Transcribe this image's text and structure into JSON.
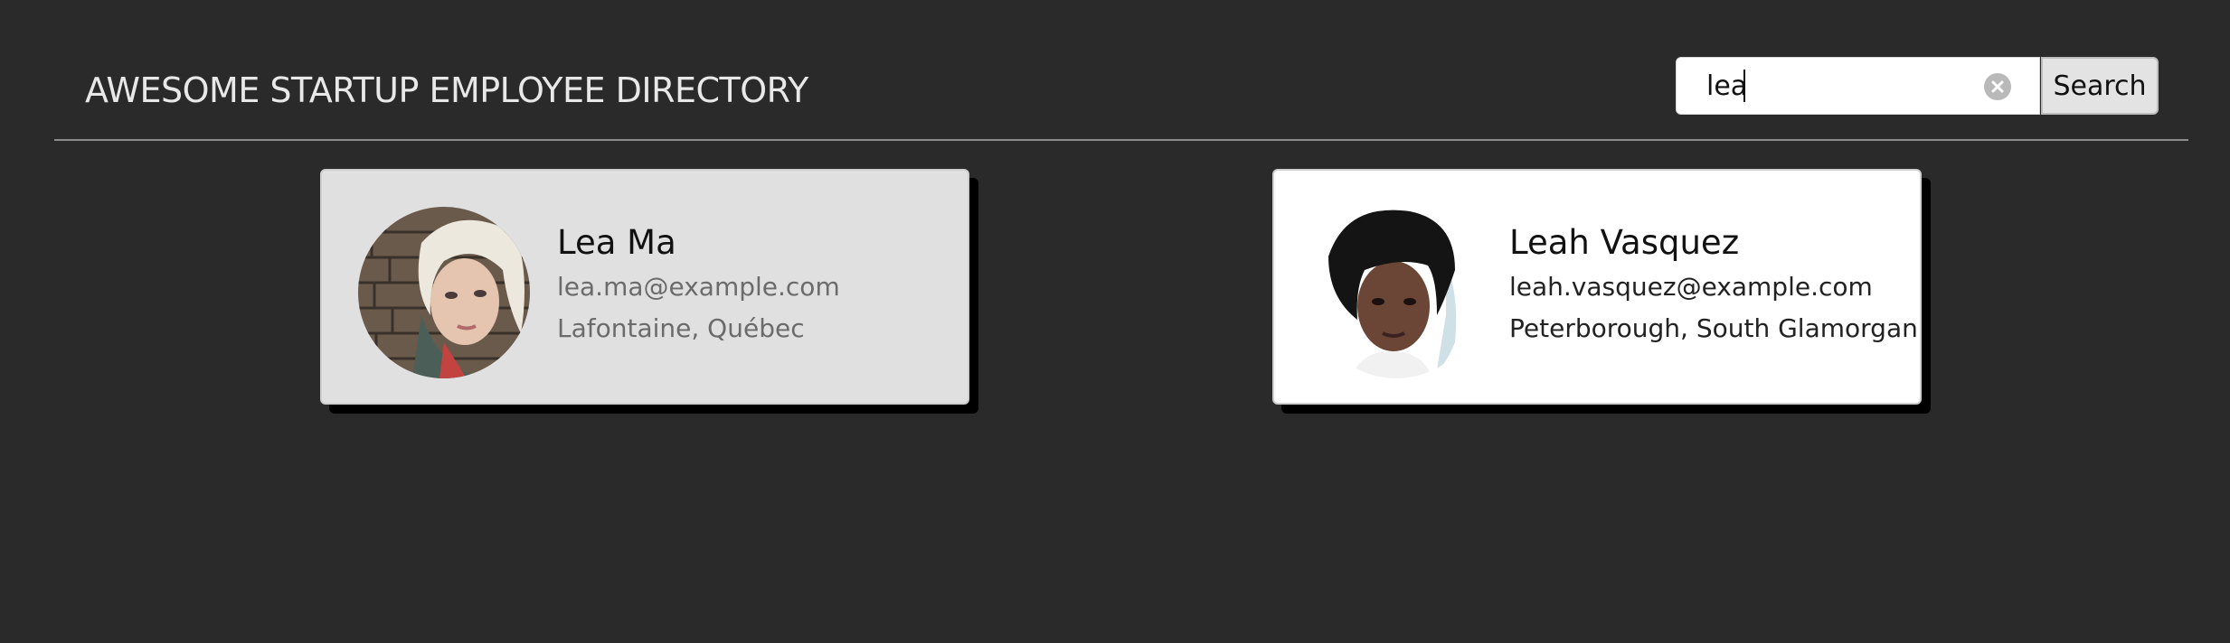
{
  "header": {
    "title": "AWESOME STARTUP EMPLOYEE DIRECTORY"
  },
  "search": {
    "value": "lea",
    "button_label": "Search"
  },
  "employees": [
    {
      "name": "Lea Ma",
      "email": "lea.ma@example.com",
      "location": "Lafontaine, Québec"
    },
    {
      "name": "Leah Vasquez",
      "email": "leah.vasquez@example.com",
      "location": "Peterborough, South Glamorgan"
    }
  ]
}
